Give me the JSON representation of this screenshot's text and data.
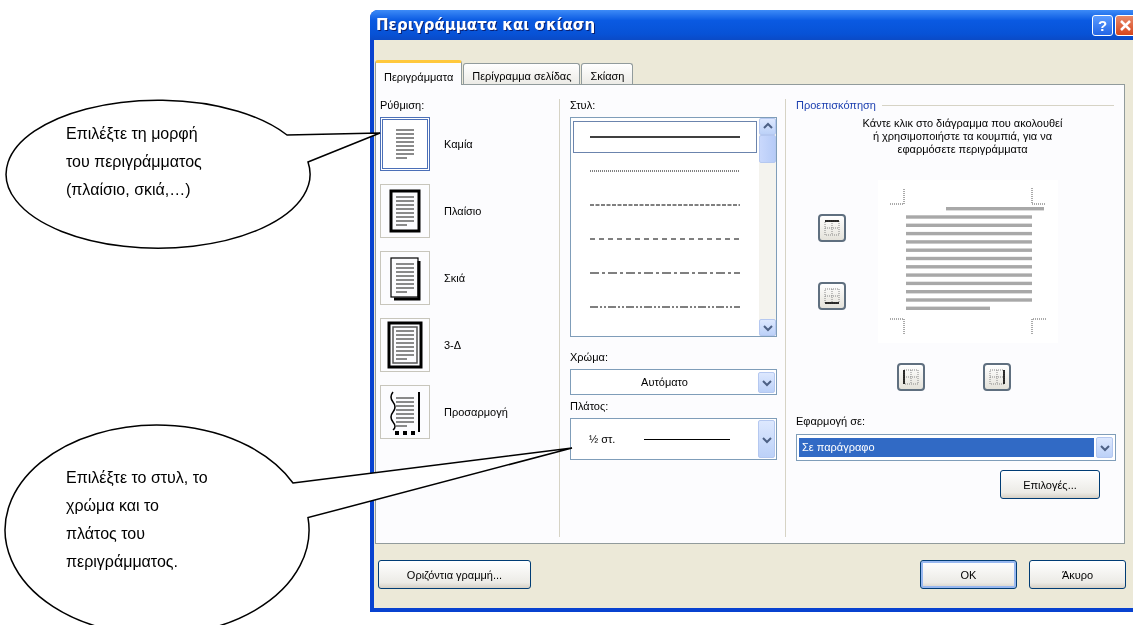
{
  "window": {
    "title": "Περιγράμματα και σκίαση",
    "help_button": "?"
  },
  "tabs": [
    {
      "label": "Περιγράμματα",
      "selected": true
    },
    {
      "label": "Περίγραμμα σελίδας",
      "selected": false
    },
    {
      "label": "Σκίαση",
      "selected": false
    }
  ],
  "setting": {
    "label": "Ρύθμιση:",
    "items": [
      {
        "kind": "none",
        "label": "Καμία",
        "selected": true
      },
      {
        "kind": "box",
        "label": "Πλαίσιο",
        "selected": false
      },
      {
        "kind": "shadow",
        "label": "Σκιά",
        "selected": false
      },
      {
        "kind": "threed",
        "label": "3-Δ",
        "selected": false
      },
      {
        "kind": "custom",
        "label": "Προσαρμογή",
        "selected": false
      }
    ]
  },
  "style": {
    "label": "Στυλ:",
    "options": [
      {
        "kind": "solid",
        "selected": true
      },
      {
        "kind": "dotted",
        "selected": false
      },
      {
        "kind": "dashed-fine",
        "selected": false
      },
      {
        "kind": "dashed",
        "selected": false
      },
      {
        "kind": "dash-dot",
        "selected": false
      },
      {
        "kind": "dash-dot-dot",
        "selected": false
      }
    ]
  },
  "color": {
    "label": "Χρώμα:",
    "value": "Αυτόματο"
  },
  "width": {
    "label": "Πλάτος:",
    "value": "½ στ."
  },
  "preview": {
    "label": "Προεπισκόπηση",
    "hint": "Κάντε κλικ στο διάγραμμα που ακολουθεί ή χρησιμοποιήστε τα κουμπιά, για να εφαρμόσετε περιγράμματα"
  },
  "apply_to": {
    "label": "Εφαρμογή σε:",
    "value": "Σε παράγραφο"
  },
  "options_button": "Επιλογές...",
  "horizontal_line_button": "Οριζόντια γραμμή...",
  "buttons": [
    {
      "label": "OK",
      "default": true
    },
    {
      "label": "Άκυρο",
      "default": false
    }
  ],
  "callouts": [
    {
      "text": "Επιλέξτε τη μορφή\nτου περιγράμματος\n(πλαίσιο, σκιά,…)"
    },
    {
      "text": "Επιλέξτε το στυλ, το\nχρώμα και το\nπλάτος του\nπεριγράμματος."
    }
  ]
}
